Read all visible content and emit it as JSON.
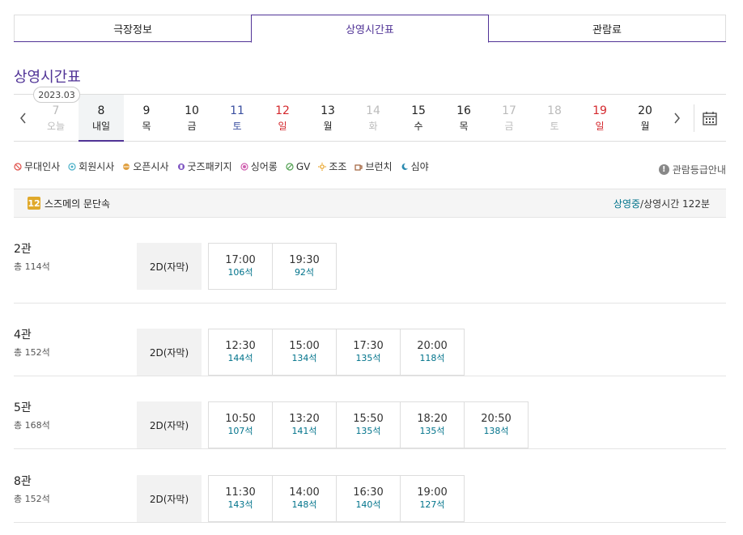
{
  "tabs": [
    {
      "label": "극장정보",
      "active": false
    },
    {
      "label": "상영시간표",
      "active": true
    },
    {
      "label": "관람료",
      "active": false
    }
  ],
  "page_title": "상영시간표",
  "year_month": "2023.03",
  "days": [
    {
      "num": "7",
      "dow": "오늘",
      "color": "#bbbbbb",
      "selected": false
    },
    {
      "num": "8",
      "dow": "내일",
      "color": "#222222",
      "selected": true
    },
    {
      "num": "9",
      "dow": "목",
      "color": "#222222",
      "selected": false
    },
    {
      "num": "10",
      "dow": "금",
      "color": "#222222",
      "selected": false
    },
    {
      "num": "11",
      "dow": "토",
      "color": "#3a4fa0",
      "selected": false
    },
    {
      "num": "12",
      "dow": "일",
      "color": "#d4282d",
      "selected": false
    },
    {
      "num": "13",
      "dow": "월",
      "color": "#222222",
      "selected": false
    },
    {
      "num": "14",
      "dow": "화",
      "color": "#bbbbbb",
      "selected": false
    },
    {
      "num": "15",
      "dow": "수",
      "color": "#222222",
      "selected": false
    },
    {
      "num": "16",
      "dow": "목",
      "color": "#222222",
      "selected": false
    },
    {
      "num": "17",
      "dow": "금",
      "color": "#bbbbbb",
      "selected": false
    },
    {
      "num": "18",
      "dow": "토",
      "color": "#bbbbbb",
      "selected": false
    },
    {
      "num": "19",
      "dow": "일",
      "color": "#d4282d",
      "selected": false
    },
    {
      "num": "20",
      "dow": "월",
      "color": "#222222",
      "selected": false
    }
  ],
  "legend": [
    {
      "label": "무대인사",
      "icon": "stage-greeting-icon",
      "color": "#e0504a"
    },
    {
      "label": "회원시사",
      "icon": "member-preview-icon",
      "color": "#4ab0c8"
    },
    {
      "label": "오픈시사",
      "icon": "open-preview-icon",
      "color": "#e0a040"
    },
    {
      "label": "굿즈패키지",
      "icon": "goods-package-icon",
      "color": "#7a4fc0"
    },
    {
      "label": "싱어롱",
      "icon": "singalong-icon",
      "color": "#d060b0"
    },
    {
      "label": "GV",
      "icon": "gv-icon",
      "color": "#50a050"
    },
    {
      "label": "조조",
      "icon": "morning-sun-icon",
      "color": "#e8a020"
    },
    {
      "label": "브런치",
      "icon": "brunch-cup-icon",
      "color": "#a0603a"
    },
    {
      "label": "심야",
      "icon": "night-moon-icon",
      "color": "#2a8ab0"
    }
  ],
  "rating_guide": "관람등급안내",
  "movie": {
    "age": "12",
    "title": "스즈메의 문단속",
    "status": "상영중",
    "runtime": "/상영시간 122분"
  },
  "screens": [
    {
      "name": "2관",
      "seats": "총 114석",
      "format": "2D(자막)",
      "times": [
        {
          "time": "17:00",
          "seats": "106석"
        },
        {
          "time": "19:30",
          "seats": "92석"
        }
      ]
    },
    {
      "name": "4관",
      "seats": "총 152석",
      "format": "2D(자막)",
      "times": [
        {
          "time": "12:30",
          "seats": "144석"
        },
        {
          "time": "15:00",
          "seats": "134석"
        },
        {
          "time": "17:30",
          "seats": "135석"
        },
        {
          "time": "20:00",
          "seats": "118석"
        }
      ]
    },
    {
      "name": "5관",
      "seats": "총 168석",
      "format": "2D(자막)",
      "times": [
        {
          "time": "10:50",
          "seats": "107석"
        },
        {
          "time": "13:20",
          "seats": "141석"
        },
        {
          "time": "15:50",
          "seats": "135석"
        },
        {
          "time": "18:20",
          "seats": "135석"
        },
        {
          "time": "20:50",
          "seats": "138석"
        }
      ]
    },
    {
      "name": "8관",
      "seats": "총 152석",
      "format": "2D(자막)",
      "times": [
        {
          "time": "11:30",
          "seats": "143석"
        },
        {
          "time": "14:00",
          "seats": "148석"
        },
        {
          "time": "16:30",
          "seats": "140석"
        },
        {
          "time": "19:00",
          "seats": "127석"
        }
      ]
    }
  ]
}
